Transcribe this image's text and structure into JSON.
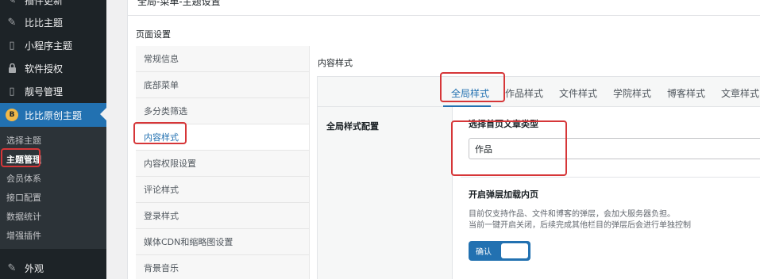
{
  "sidebar": {
    "items": [
      {
        "icon": "plugin-icon",
        "label": "插件更新",
        "glyph": "✎"
      },
      {
        "icon": "pin-icon",
        "label": "比比主题",
        "glyph": "✎"
      },
      {
        "icon": "phone-icon",
        "label": "小程序主题",
        "glyph": "▯"
      },
      {
        "icon": "lock-icon",
        "label": "软件授权",
        "glyph": "🔒"
      },
      {
        "icon": "phone-icon",
        "label": "靓号管理",
        "glyph": "▯"
      },
      {
        "icon": "logo-icon",
        "label": "比比原创主题",
        "glyph": "B"
      },
      {
        "icon": "brush-icon",
        "label": "外观",
        "glyph": "✎"
      }
    ],
    "submenu": [
      "选择主题",
      "主题管理",
      "会员体系",
      "接口配置",
      "数据统计",
      "增强插件"
    ]
  },
  "header": {
    "breadcrumb": "全局-菜单-主题设置"
  },
  "page": {
    "section_title": "页面设置"
  },
  "left_nav": [
    "常规信息",
    "底部菜单",
    "多分类筛选",
    "内容样式",
    "内容权限设置",
    "评论样式",
    "登录样式",
    "媒体CDN和缩略图设置",
    "背景音乐"
  ],
  "content": {
    "title": "内容样式",
    "tabs": [
      "全局样式",
      "作品样式",
      "文件样式",
      "学院样式",
      "博客样式",
      "文章样式"
    ],
    "field_label": "全局样式配置",
    "option1": {
      "title": "选择首页文章类型",
      "value": "作品"
    },
    "option2": {
      "title": "开启弹层加载内页",
      "desc1": "目前仅支持作品、文件和博客的弹层，会加大服务器负担。",
      "desc2": "当前一键开启关闭，后续完成其他栏目的弹层后会进行单独控制",
      "toggle_label": "确认"
    }
  },
  "colors": {
    "accent": "#2271b1",
    "highlight": "#d63638",
    "sidebar_bg": "#1d2327"
  }
}
